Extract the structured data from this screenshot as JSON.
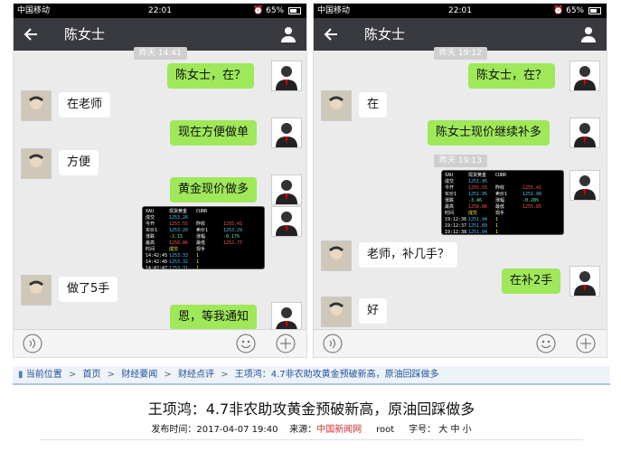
{
  "phones": [
    {
      "status": {
        "carrier": "中国移动",
        "time": "22:01",
        "battery": "65%",
        "battery_level": 0.65
      },
      "title": "陈女士",
      "timestamps": [
        "昨天 14:41"
      ],
      "messages": [
        {
          "side": "me",
          "text": "陈女士，在？"
        },
        {
          "side": "other",
          "text": "在老师"
        },
        {
          "side": "me",
          "text": "现在方便做单"
        },
        {
          "side": "other",
          "text": "方便"
        },
        {
          "side": "me",
          "text": "黄金现价做多"
        },
        {
          "side": "other",
          "text": "做了5手"
        },
        {
          "side": "me",
          "text": "恩，等我通知"
        }
      ],
      "quote_image": {
        "rows": [
          [
            "XAU",
            "现货黄金",
            "CURR",
            ""
          ],
          [
            "成交",
            "1253.26",
            "",
            ""
          ],
          [
            "今开",
            "1255.55",
            "昨收",
            "1255.41"
          ],
          [
            "买价1",
            "1253.26",
            "卖价1",
            "1253.29"
          ],
          [
            "涨跌",
            "-2.15",
            "涨幅",
            "-0.17%"
          ],
          [
            "最高",
            "1258.86",
            "最低",
            "1252.77"
          ],
          [
            "时间",
            "成交",
            "现手",
            ""
          ],
          [
            "14:42:45",
            "1253.33",
            "1",
            ""
          ],
          [
            "14:42:46",
            "1253.32",
            "1",
            ""
          ],
          [
            "14:42:47",
            "1253.31",
            "1",
            ""
          ]
        ]
      }
    },
    {
      "status": {
        "carrier": "中国移动",
        "time": "22:01",
        "battery": "65%",
        "battery_level": 0.65
      },
      "title": "陈女士",
      "timestamps": [
        "昨天 19:12",
        "昨天 19:13"
      ],
      "messages": [
        {
          "side": "me",
          "text": "陈女士，在？"
        },
        {
          "side": "other",
          "text": "在"
        },
        {
          "side": "me",
          "text": "陈女士现价继续补多"
        },
        {
          "side": "other",
          "text": "老师，补几手？"
        },
        {
          "side": "me",
          "text": "在补2手"
        },
        {
          "side": "other",
          "text": "好"
        }
      ],
      "quote_image": {
        "rows": [
          [
            "XAU",
            "现货黄金",
            "CURR",
            ""
          ],
          [
            "成交",
            "1251.95",
            "",
            ""
          ],
          [
            "今开",
            "1255.55",
            "昨收",
            "1255.41"
          ],
          [
            "买价1",
            "1251.95",
            "卖价1",
            "1251.98"
          ],
          [
            "涨跌",
            "-3.46",
            "涨幅",
            "-0.28%"
          ],
          [
            "最高",
            "1258.86",
            "最低",
            "1255.85"
          ],
          [
            "时间",
            "成交",
            "现手",
            ""
          ],
          [
            "19:12:36",
            "1251.94",
            "1",
            ""
          ],
          [
            "19:12:37",
            "1251.89",
            "1",
            ""
          ],
          [
            "19:12:38",
            "1251.94",
            "1",
            ""
          ]
        ]
      }
    }
  ],
  "article": {
    "breadcrumb": [
      "当前位置",
      "首页",
      "财经要闻",
      "财经点评",
      "王项鸿：4.7非农助攻黄金预破新高，原油回踩做多"
    ],
    "title": "王项鸿：4.7非农助攻黄金预破新高，原油回踩做多",
    "meta": {
      "publish_label": "发布时间：",
      "publish_time": "2017-04-07 19:40",
      "source_label": "来源：",
      "source": "中国新闻网",
      "author": "root",
      "font_label": "字号：",
      "font_sizes": [
        "大",
        "中",
        "小"
      ]
    }
  },
  "colors": {
    "titlebar": "#393a3f",
    "my_bubble": "#9ee85a",
    "chat_bg": "#ebebeb",
    "link": "#1f4f99",
    "source": "#d32f2f"
  }
}
